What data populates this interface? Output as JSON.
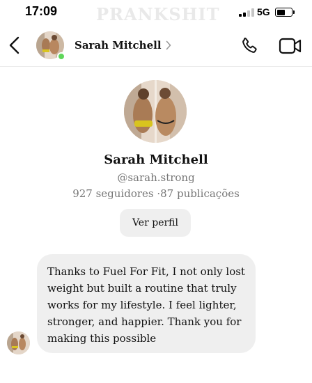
{
  "status_bar": {
    "time": "17:09",
    "watermark": "PRANKSHIT",
    "network": "5G",
    "signal_bars_active": 2,
    "signal_bars_total": 4,
    "battery_level": 0.6
  },
  "header": {
    "contact_name": "Sarah Mitchell",
    "online": true,
    "online_color": "#5fd65a",
    "icons": [
      "back-icon",
      "chevron-right-icon",
      "phone-icon",
      "video-camera-icon"
    ]
  },
  "profile": {
    "name": "Sarah Mitchell",
    "handle": "@sarah.strong",
    "stats": "927 seguidores ·87 publicações",
    "view_profile_label": "Ver perfil"
  },
  "messages": [
    {
      "direction": "incoming",
      "text": "Thanks to Fuel For Fit, I not only lost weight but built a routine that truly works for my lifestyle. I feel lighter, stronger, and happier. Thank you for making this possible"
    }
  ],
  "colors": {
    "bubble_bg": "#efefef",
    "button_bg": "#efefef",
    "secondary_text": "#777777"
  }
}
